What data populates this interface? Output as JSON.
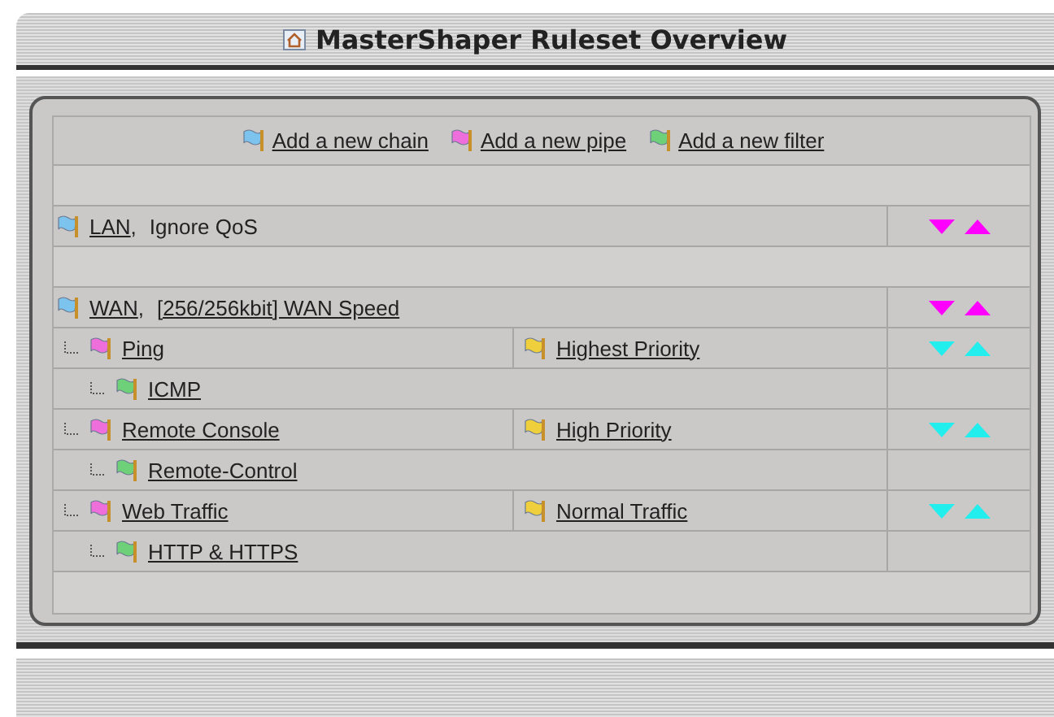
{
  "window": {
    "title": "MasterShaper Ruleset Overview"
  },
  "actions": [
    {
      "kind": "chain",
      "label": "Add a new chain"
    },
    {
      "kind": "pipe",
      "label": "Add a new pipe"
    },
    {
      "kind": "filter",
      "label": "Add a new filter"
    }
  ],
  "chains": [
    {
      "name": "LAN",
      "separator": ",",
      "service_level": {
        "text": "Ignore QoS",
        "link": false
      }
    },
    {
      "name": "WAN",
      "separator": ",",
      "service_level": {
        "text": "[256/256kbit] WAN Speed",
        "link": true
      },
      "pipes": [
        {
          "name": "Ping",
          "target": "Highest Priority",
          "filters": [
            "ICMP"
          ]
        },
        {
          "name": "Remote Console",
          "target": "High Priority",
          "filters": [
            "Remote-Control"
          ]
        },
        {
          "name": "Web Traffic",
          "target": "Normal Traffic",
          "filters": [
            "HTTP & HTTPS"
          ]
        }
      ]
    }
  ]
}
